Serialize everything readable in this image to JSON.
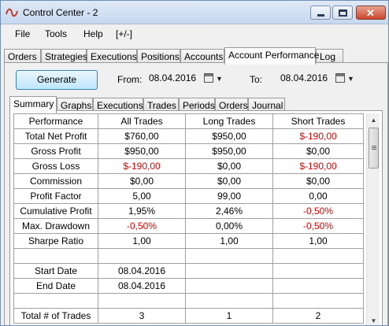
{
  "window": {
    "title": "Control Center - 2",
    "buttons": {
      "minimize": "minimize",
      "maximize": "maximize",
      "close": "✕"
    }
  },
  "menu": [
    "File",
    "Tools",
    "Help",
    "[+/-]"
  ],
  "main_tabs": [
    "Orders",
    "Strategies",
    "Executions",
    "Positions",
    "Accounts",
    "Account Performance",
    "Log"
  ],
  "main_tab_active": "Account Performance",
  "toolbar": {
    "generate_label": "Generate",
    "from_label": "From:",
    "from_value": "08.04.2016",
    "to_label": "To:",
    "to_value": "08.04.2016"
  },
  "sub_tabs": [
    "Summary",
    "Graphs",
    "Executions",
    "Trades",
    "Periods",
    "Orders",
    "Journal"
  ],
  "sub_tab_active": "Summary",
  "table": {
    "headers": [
      "Performance",
      "All Trades",
      "Long Trades",
      "Short Trades"
    ],
    "rows": [
      [
        "Total Net Profit",
        "$760,00",
        "$950,00",
        "$-190,00"
      ],
      [
        "Gross Profit",
        "$950,00",
        "$950,00",
        "$0,00"
      ],
      [
        "Gross Loss",
        "$-190,00",
        "$0,00",
        "$-190,00"
      ],
      [
        "Commission",
        "$0,00",
        "$0,00",
        "$0,00"
      ],
      [
        "Profit Factor",
        "5,00",
        "99,00",
        "0,00"
      ],
      [
        "Cumulative Profit",
        "1,95%",
        "2,46%",
        "-0,50%"
      ],
      [
        "Max. Drawdown",
        "-0,50%",
        "0,00%",
        "-0,50%"
      ],
      [
        "Sharpe Ratio",
        "1,00",
        "1,00",
        "1,00"
      ],
      [
        "",
        "",
        "",
        ""
      ],
      [
        "Start Date",
        "08.04.2016",
        "",
        ""
      ],
      [
        "End Date",
        "08.04.2016",
        "",
        ""
      ],
      [
        "",
        "",
        "",
        ""
      ],
      [
        "Total # of Trades",
        "3",
        "1",
        "2"
      ]
    ]
  },
  "colors": {
    "negative": "#e00000",
    "title_bar": "#c7d8ee"
  }
}
